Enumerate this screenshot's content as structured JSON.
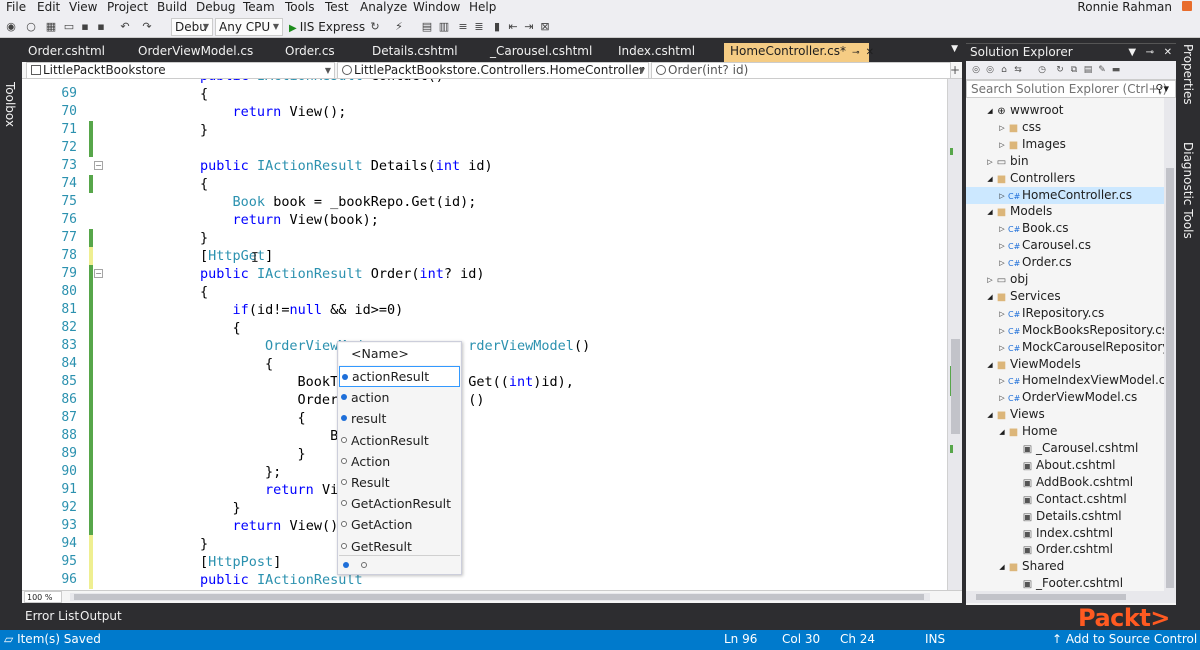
{
  "menu": [
    "File",
    "Edit",
    "View",
    "Project",
    "Build",
    "Debug",
    "Team",
    "Tools",
    "Test",
    "Analyze",
    "Window",
    "Help"
  ],
  "user_name": "Ronnie Rahman",
  "toolbar": {
    "config": "Debu",
    "platform": "Any CPU",
    "run_target": "IIS Express"
  },
  "toolbox_label": "Toolbox",
  "tabs": [
    {
      "label": "Order.cshtml",
      "active": false
    },
    {
      "label": "OrderViewModel.cs",
      "active": false
    },
    {
      "label": "Order.cs",
      "active": false
    },
    {
      "label": "Details.cshtml",
      "active": false
    },
    {
      "label": "_Carousel.cshtml",
      "active": false
    },
    {
      "label": "Index.cshtml",
      "active": false
    },
    {
      "label": "HomeController.cs*",
      "active": true
    }
  ],
  "navbar": {
    "project": "LittlePacktBookstore",
    "type": "LittlePacktBookstore.Controllers.HomeController",
    "member": "Order(int? id)"
  },
  "code_lines": [
    {
      "n": "69",
      "html": "        {"
    },
    {
      "n": "70",
      "html": "            return View();"
    },
    {
      "n": "71",
      "html": "        }"
    },
    {
      "n": "72",
      "html": ""
    },
    {
      "n": "73",
      "html": "        public IActionResult Details(int id)"
    },
    {
      "n": "74",
      "html": "        {"
    },
    {
      "n": "75",
      "html": "            Book book = _bookRepo.Get(id);"
    },
    {
      "n": "76",
      "html": "            return View(book);"
    },
    {
      "n": "77",
      "html": "        }"
    },
    {
      "n": "78",
      "html": "        [HttpGet]"
    },
    {
      "n": "79",
      "html": "        public IActionResult Order(int? id)"
    },
    {
      "n": "80",
      "html": "        {"
    },
    {
      "n": "81",
      "html": "            if(id!=null && id>=0)"
    },
    {
      "n": "82",
      "html": "            {"
    },
    {
      "n": "83",
      "html": "                OrderViewMode            rderViewModel()"
    },
    {
      "n": "84",
      "html": "                {"
    },
    {
      "n": "85",
      "html": "                    BookToOrd            Get((int)id),"
    },
    {
      "n": "86",
      "html": "                    OrderDeta            ()"
    },
    {
      "n": "87",
      "html": "                    {"
    },
    {
      "n": "88",
      "html": "                        BookI"
    },
    {
      "n": "89",
      "html": "                    }"
    },
    {
      "n": "90",
      "html": "                };"
    },
    {
      "n": "91",
      "html": "                return View(m"
    },
    {
      "n": "92",
      "html": "            }"
    },
    {
      "n": "93",
      "html": "            return View();"
    },
    {
      "n": "94",
      "html": "        }"
    },
    {
      "n": "95",
      "html": "        [HttpPost]"
    },
    {
      "n": "96",
      "html": "        public IActionResult"
    }
  ],
  "intellisense": {
    "header": "<Name>",
    "items": [
      {
        "label": "actionResult",
        "kind": "local",
        "selected": true
      },
      {
        "label": "action",
        "kind": "local",
        "selected": false
      },
      {
        "label": "result",
        "kind": "local",
        "selected": false
      },
      {
        "label": "ActionResult",
        "kind": "type",
        "selected": false
      },
      {
        "label": "Action",
        "kind": "type",
        "selected": false
      },
      {
        "label": "Result",
        "kind": "type",
        "selected": false
      },
      {
        "label": "GetActionResult",
        "kind": "type",
        "selected": false
      },
      {
        "label": "GetAction",
        "kind": "type",
        "selected": false
      },
      {
        "label": "GetResult",
        "kind": "type",
        "selected": false
      }
    ]
  },
  "zoom": "100 %",
  "bottom_tabs": [
    "Error List",
    "Output"
  ],
  "solution_explorer": {
    "title": "Solution Explorer",
    "search_placeholder": "Search Solution Explorer (Ctrl+;)",
    "tree": [
      {
        "label": "wwwroot",
        "level": 1,
        "arrow": "down",
        "icon": "globe"
      },
      {
        "label": "css",
        "level": 2,
        "arrow": "right",
        "icon": "folder"
      },
      {
        "label": "Images",
        "level": 2,
        "arrow": "right",
        "icon": "folder"
      },
      {
        "label": "bin",
        "level": 1,
        "arrow": "right",
        "icon": "folder-outline"
      },
      {
        "label": "Controllers",
        "level": 1,
        "arrow": "down",
        "icon": "folder"
      },
      {
        "label": "HomeController.cs",
        "level": 2,
        "arrow": "right",
        "icon": "cs",
        "selected": true
      },
      {
        "label": "Models",
        "level": 1,
        "arrow": "down",
        "icon": "folder"
      },
      {
        "label": "Book.cs",
        "level": 2,
        "arrow": "right",
        "icon": "cs"
      },
      {
        "label": "Carousel.cs",
        "level": 2,
        "arrow": "right",
        "icon": "cs"
      },
      {
        "label": "Order.cs",
        "level": 2,
        "arrow": "right",
        "icon": "cs"
      },
      {
        "label": "obj",
        "level": 1,
        "arrow": "right",
        "icon": "folder-outline"
      },
      {
        "label": "Services",
        "level": 1,
        "arrow": "down",
        "icon": "folder"
      },
      {
        "label": "IRepository.cs",
        "level": 2,
        "arrow": "right",
        "icon": "cs"
      },
      {
        "label": "MockBooksRepository.cs",
        "level": 2,
        "arrow": "right",
        "icon": "cs"
      },
      {
        "label": "MockCarouselRepository.cs",
        "level": 2,
        "arrow": "right",
        "icon": "cs"
      },
      {
        "label": "ViewModels",
        "level": 1,
        "arrow": "down",
        "icon": "folder"
      },
      {
        "label": "HomeIndexViewModel.cs",
        "level": 2,
        "arrow": "right",
        "icon": "cs"
      },
      {
        "label": "OrderViewModel.cs",
        "level": 2,
        "arrow": "right",
        "icon": "cs"
      },
      {
        "label": "Views",
        "level": 1,
        "arrow": "down",
        "icon": "folder"
      },
      {
        "label": "Home",
        "level": 2,
        "arrow": "down",
        "icon": "folder"
      },
      {
        "label": "_Carousel.cshtml",
        "level": 3,
        "arrow": "",
        "icon": "doc"
      },
      {
        "label": "About.cshtml",
        "level": 3,
        "arrow": "",
        "icon": "doc"
      },
      {
        "label": "AddBook.cshtml",
        "level": 3,
        "arrow": "",
        "icon": "doc"
      },
      {
        "label": "Contact.cshtml",
        "level": 3,
        "arrow": "",
        "icon": "doc"
      },
      {
        "label": "Details.cshtml",
        "level": 3,
        "arrow": "",
        "icon": "doc"
      },
      {
        "label": "Index.cshtml",
        "level": 3,
        "arrow": "",
        "icon": "doc"
      },
      {
        "label": "Order.cshtml",
        "level": 3,
        "arrow": "",
        "icon": "doc"
      },
      {
        "label": "Shared",
        "level": 2,
        "arrow": "down",
        "icon": "folder"
      },
      {
        "label": "_Footer.cshtml",
        "level": 3,
        "arrow": "",
        "icon": "doc"
      }
    ]
  },
  "right_strip": {
    "properties": "Properties",
    "diagnostic": "Diagnostic Tools"
  },
  "statusbar": {
    "message": "Item(s) Saved",
    "ln": "Ln 96",
    "col": "Col 30",
    "ch": "Ch 24",
    "ins": "INS",
    "source_control": "Add to Source Control"
  },
  "watermark": "Packt>"
}
